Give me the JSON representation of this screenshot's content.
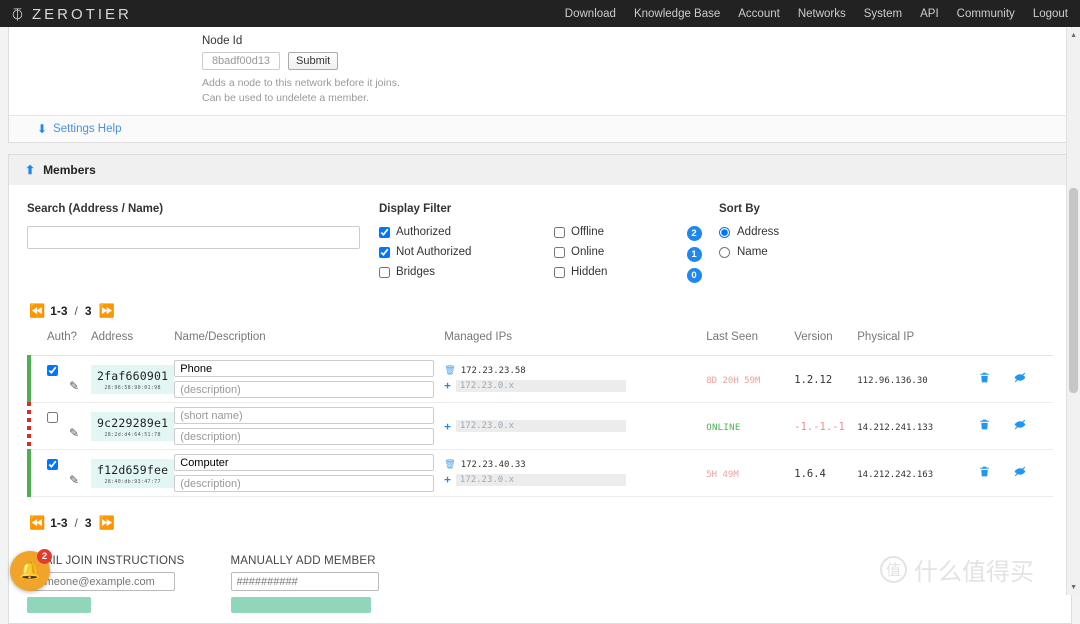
{
  "navbar": {
    "brand": "ZEROTIER",
    "links": [
      {
        "label": "Download"
      },
      {
        "label": "Knowledge Base"
      },
      {
        "label": "Account"
      },
      {
        "label": "Networks"
      },
      {
        "label": "System"
      },
      {
        "label": "API"
      },
      {
        "label": "Community"
      },
      {
        "label": "Logout"
      }
    ]
  },
  "node_add": {
    "label": "Node Id",
    "placeholder": "8badf00d13",
    "value": "",
    "submit_label": "Submit",
    "hint_line1": "Adds a node to this network before it joins.",
    "hint_line2": "Can be used to undelete a member."
  },
  "settings_help": {
    "label": "Settings Help",
    "icon": "arrow-down-icon"
  },
  "members_section": {
    "title": "Members",
    "icon": "arrow-up-icon"
  },
  "search": {
    "label": "Search (Address / Name)",
    "value": "",
    "placeholder": ""
  },
  "display_filter": {
    "label": "Display Filter",
    "left": [
      {
        "label": "Authorized",
        "checked": true
      },
      {
        "label": "Not Authorized",
        "checked": true
      },
      {
        "label": "Bridges",
        "checked": false
      }
    ],
    "right": [
      {
        "label": "Offline",
        "checked": false,
        "count": "2"
      },
      {
        "label": "Online",
        "checked": false,
        "count": "1"
      },
      {
        "label": "Hidden",
        "checked": false,
        "count": "0"
      }
    ]
  },
  "sort_by": {
    "label": "Sort By",
    "options": [
      {
        "label": "Address",
        "selected": true
      },
      {
        "label": "Name",
        "selected": false
      }
    ]
  },
  "pager": {
    "first_icon": "skip-back-icon",
    "range": "1-3",
    "sep": "/",
    "total": "3",
    "last_icon": "skip-forward-icon"
  },
  "table": {
    "columns": [
      "Auth?",
      "Address",
      "Name/Description",
      "Managed IPs",
      "Last Seen",
      "Version",
      "Physical IP"
    ],
    "rows": [
      {
        "authorized": true,
        "edit_icon": "pencil-icon",
        "address": "2faf660901",
        "mac": "28:96:58:90:01:98",
        "name_value": "Phone",
        "name_placeholder": "(short name)",
        "desc_value": "",
        "desc_placeholder": "(description)",
        "managed_ips": [
          "172.23.23.58"
        ],
        "ip_add_placeholder": "172.23.0.x",
        "last_seen": "8D 20H 59M",
        "last_seen_online": false,
        "version": "1.2.12",
        "version_bad": false,
        "physical_ip": "112.96.136.30",
        "delete_icon": "trash-icon",
        "hide_icon": "eye-slash-icon"
      },
      {
        "authorized": false,
        "edit_icon": "pencil-icon",
        "address": "9c229289e1",
        "mac": "28:2d:d4:64:51:78",
        "name_value": "",
        "name_placeholder": "(short name)",
        "desc_value": "",
        "desc_placeholder": "(description)",
        "managed_ips": [],
        "ip_add_placeholder": "172.23.0.x",
        "last_seen": "ONLINE",
        "last_seen_online": true,
        "version": "-1.-1.-1",
        "version_bad": true,
        "physical_ip": "14.212.241.133",
        "delete_icon": "trash-icon",
        "hide_icon": "eye-slash-icon"
      },
      {
        "authorized": true,
        "edit_icon": "pencil-icon",
        "address": "f12d659fee",
        "mac": "28:40:db:93:47:77",
        "name_value": "Computer",
        "name_placeholder": "(short name)",
        "desc_value": "",
        "desc_placeholder": "(description)",
        "managed_ips": [
          "172.23.40.33"
        ],
        "ip_add_placeholder": "172.23.0.x",
        "last_seen": "5H 49M",
        "last_seen_online": false,
        "version": "1.6.4",
        "version_bad": false,
        "physical_ip": "14.212.242.163",
        "delete_icon": "trash-icon",
        "hide_icon": "eye-slash-icon"
      }
    ]
  },
  "bottom": {
    "email_title": "EMAIL JOIN INSTRUCTIONS",
    "email_placeholder": "someone@example.com",
    "manual_title": "MANUALLY ADD MEMBER",
    "manual_placeholder": "##########"
  },
  "notification": {
    "icon": "bell-icon",
    "count": "2"
  },
  "watermark": {
    "mark": "值",
    "text": "什么值得买"
  },
  "colors": {
    "accent_blue": "#1e87f0",
    "authorized_green": "#4caf50",
    "unauthorized_red": "#d32f2f",
    "badge_blue": "#1e87f0",
    "address_bg": "#e2f7f4",
    "bell_orange": "#f0a429"
  }
}
